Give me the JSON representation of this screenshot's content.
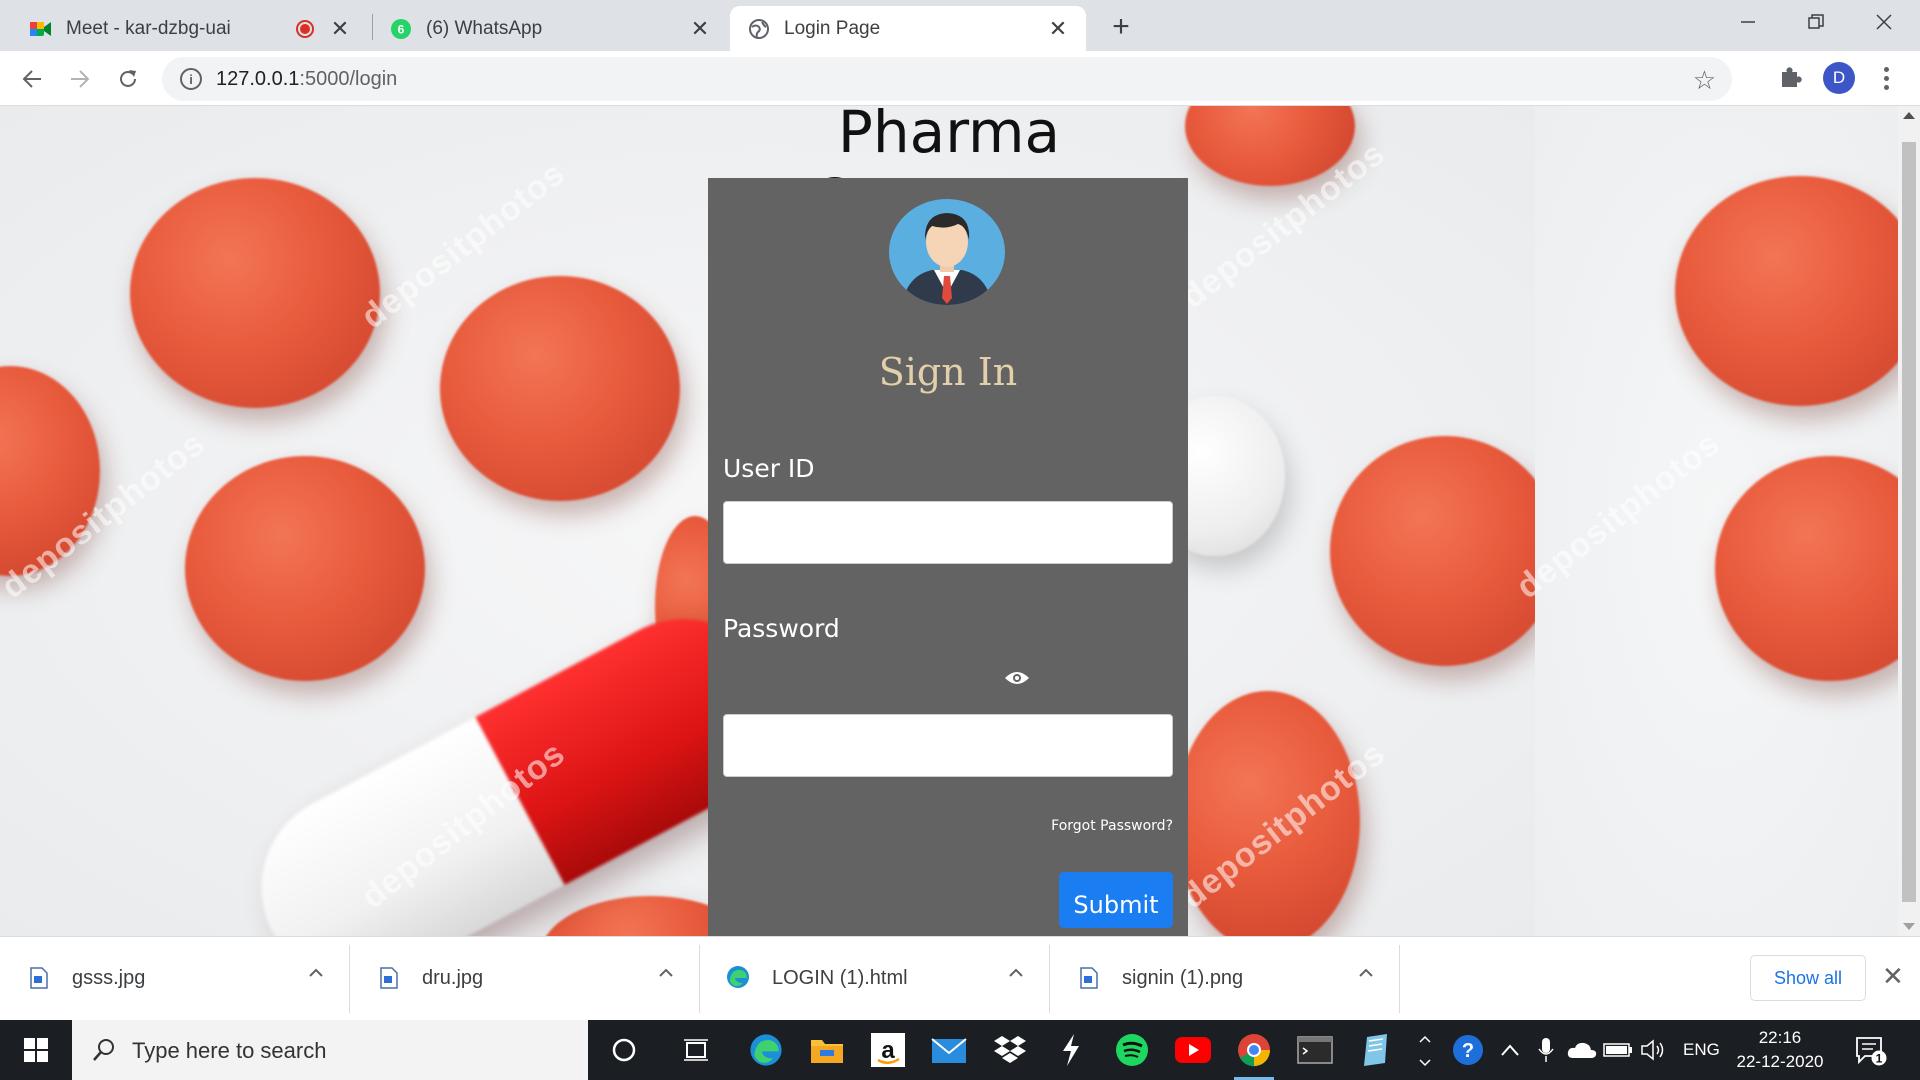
{
  "browser": {
    "tabs": [
      {
        "label": "Meet - kar-dzbg-uai",
        "icon": "google-meet-icon",
        "recording": true
      },
      {
        "label": "(6) WhatsApp",
        "icon": "whatsapp-icon",
        "badge": "6"
      },
      {
        "label": "Login Page",
        "icon": "globe-icon",
        "active": true
      }
    ],
    "url_host": "127.0.0.1",
    "url_path": ":5000/login",
    "profile_initial": "D"
  },
  "page": {
    "title": "Pharma Company",
    "signin_heading": "Sign In",
    "userid_label": "User ID",
    "userid_value": "",
    "password_label": "Password",
    "password_value": "",
    "forgot_label": "Forgot Password?",
    "submit_label": "Submit"
  },
  "downloads": {
    "items": [
      {
        "name": "gsss.jpg",
        "icon": "image-file-icon"
      },
      {
        "name": "dru.jpg",
        "icon": "image-file-icon"
      },
      {
        "name": "LOGIN (1).html",
        "icon": "edge-icon"
      },
      {
        "name": "signin (1).png",
        "icon": "image-file-icon"
      }
    ],
    "show_all_label": "Show all"
  },
  "taskbar": {
    "search_placeholder": "Type here to search",
    "language": "ENG",
    "time": "22:16",
    "date": "22-12-2020",
    "notification_count": "1"
  },
  "colors": {
    "card_bg": "#636363",
    "signin_heading": "#e3cfa9",
    "submit_bg": "#1a7ef2",
    "pill_red": "#e85a3c"
  }
}
